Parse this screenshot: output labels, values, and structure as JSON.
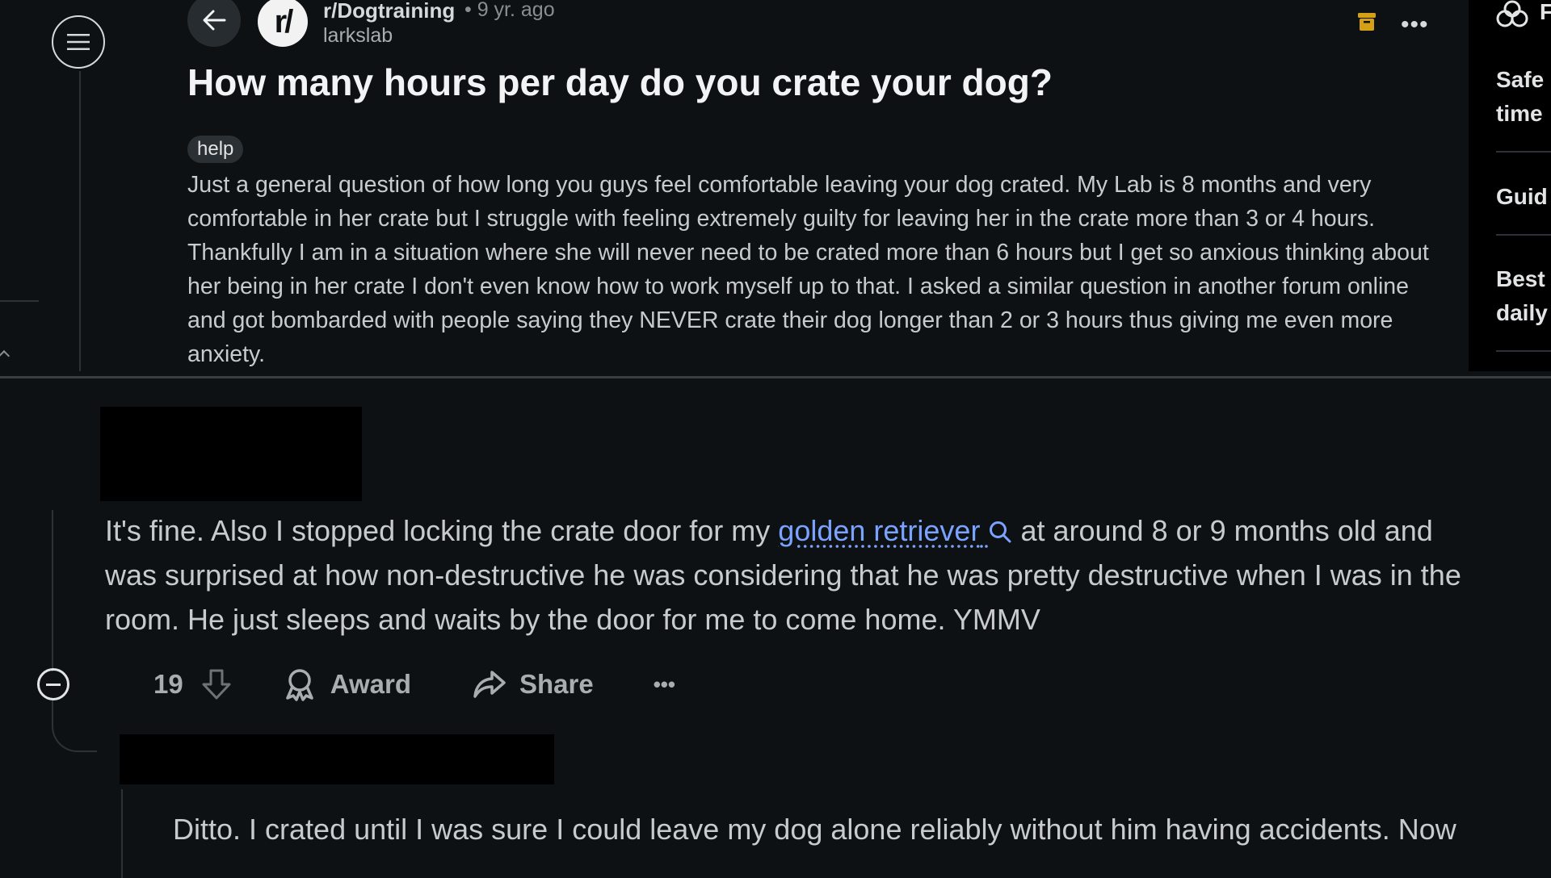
{
  "post": {
    "subreddit": "r/Dogtraining",
    "avatar_glyph": "r/",
    "time": "• 9 yr. ago",
    "author": "larkslab",
    "title": "How many hours per day do you crate your dog?",
    "flair": "help",
    "body": "Just a general question of how long you guys feel comfortable leaving your dog crated. My Lab is 8 months and very comfortable in her crate but I struggle with feeling extremely guilty for leaving her in the crate more than 3 or 4 hours. Thankfully I am in a situation where she will never need to be crated more than 6 hours but I get so anxious thinking about her being in her crate I don't even know how to work myself up to that. I asked a similar question in another forum online and got bombarded with people saying they NEVER crate their dog longer than 2 or 3 hours thus giving me even more anxiety.",
    "more_glyph": "•••"
  },
  "sidebar": {
    "header_fragment": "F",
    "items": [
      {
        "line1": "Safe",
        "line2": "time"
      },
      {
        "line1": "Guid",
        "line2": ""
      },
      {
        "line1": "Best",
        "line2": "daily"
      }
    ]
  },
  "comment": {
    "line1_before": "It's fine. Also I stopped locking the crate door for my ",
    "link_text": "golden retriever",
    "line1_after": " at around 8 or 9 months old and",
    "line2": "was surprised at how non-destructive he was considering that he was pretty destructive when I was in the",
    "line3": "room. He just sleeps and waits by the door for me to come home. YMMV",
    "score": "19",
    "award_label": "Award",
    "share_label": "Share",
    "more_glyph": "•••"
  },
  "reply": {
    "line1": "Ditto. I crated until I was sure I could leave my dog alone reliably without him having accidents. Now"
  },
  "colors": {
    "background": "#0e1113",
    "link": "#7aa2ff",
    "archive_icon": "#d4a017"
  }
}
